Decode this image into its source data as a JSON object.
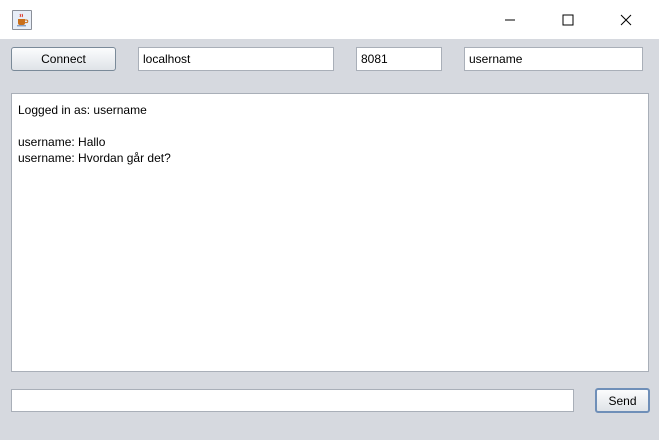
{
  "window": {
    "icons": {
      "app": "java-cup-icon",
      "minimize": "minimize-icon",
      "maximize": "maximize-icon",
      "close": "close-icon"
    }
  },
  "toolbar": {
    "connect_label": "Connect",
    "host_value": "localhost",
    "port_value": "8081",
    "username_value": "username"
  },
  "chat": {
    "status_line": "Logged in as: username",
    "messages": [
      {
        "text": "username: Hallo"
      },
      {
        "text": "username: Hvordan går det?"
      }
    ]
  },
  "composer": {
    "message_value": "",
    "send_label": "Send"
  }
}
